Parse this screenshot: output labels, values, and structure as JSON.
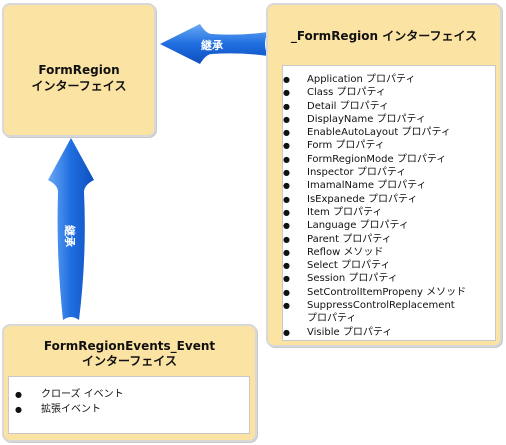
{
  "form_region": {
    "title_line1": "FormRegion",
    "title_line2": "インターフェイス"
  },
  "underscore_form_region": {
    "title": "_FormRegion インターフェイス",
    "items": [
      "Application プロパティ",
      "Class プロパティ",
      "Detail プロパティ",
      "DisplayName プロパティ",
      "EnableAutoLayout プロパティ",
      "Form プロパティ",
      "FormRegionMode プロパティ",
      "Inspector プロパティ",
      "ImamalName プロパティ",
      "IsExpanede プロパティ",
      "Item プロパティ",
      "Language プロパティ",
      "Parent プロパティ",
      "Reflow メソッド",
      "Select プロパティ",
      "Session プロパティ",
      "SetControlItemPropeny メソッド",
      "SuppressControlReplacement",
      "Visible プロパティ"
    ],
    "item_continuation": "プロパティ"
  },
  "form_region_events": {
    "title_line1": "FormRegionEvents_Event",
    "title_line2": "インターフェイス",
    "items": [
      "クローズ イベント",
      "拡張イベント"
    ]
  },
  "arrows": {
    "horizontal_label": "継承",
    "vertical_label": "継承",
    "color": "#1c6fe0"
  },
  "colors": {
    "box_fill": "#fbe3a3",
    "box_border": "#d8d8d8"
  }
}
